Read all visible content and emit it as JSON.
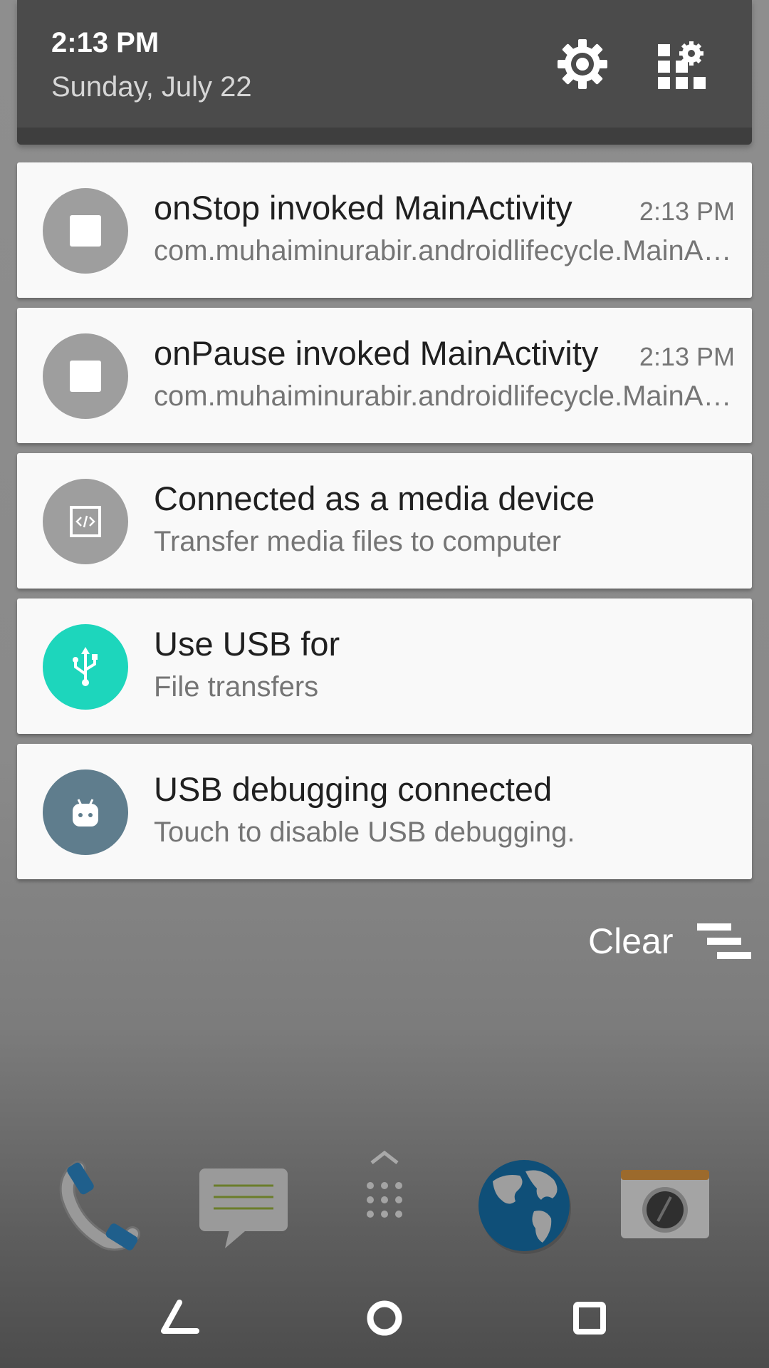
{
  "header": {
    "time": "2:13 PM",
    "date": "Sunday, July 22",
    "settings_icon": "gear-icon",
    "qs_icon": "quick-settings-grid-icon"
  },
  "notifications": [
    {
      "title": "onStop invoked MainActivity",
      "subtitle": "com.muhaiminurabir.androidlifecycle.MainActivity",
      "time": "2:13 PM",
      "icon": "stop-square-icon",
      "icon_color": "#9e9e9e"
    },
    {
      "title": "onPause invoked MainActivity",
      "subtitle": "com.muhaiminurabir.androidlifecycle.MainActivity",
      "time": "2:13 PM",
      "icon": "stop-square-icon",
      "icon_color": "#9e9e9e"
    },
    {
      "title": "Connected as a media device",
      "subtitle": "Transfer media files to computer",
      "icon": "code-window-icon",
      "icon_color": "#9e9e9e"
    },
    {
      "title": "Use USB for",
      "subtitle": "File transfers",
      "icon": "usb-icon",
      "icon_color": "#1dd6bc"
    },
    {
      "title": "USB debugging connected",
      "subtitle": "Touch to disable USB debugging.",
      "icon": "android-bug-icon",
      "icon_color": "#5f7d8d"
    }
  ],
  "clear": {
    "label": "Clear",
    "icon": "clear-all-icon"
  },
  "dock": [
    "phone-icon",
    "messaging-icon",
    "app-drawer-icon",
    "browser-globe-icon",
    "camera-icon"
  ],
  "navbar": [
    "back-icon",
    "home-icon",
    "recents-icon"
  ]
}
